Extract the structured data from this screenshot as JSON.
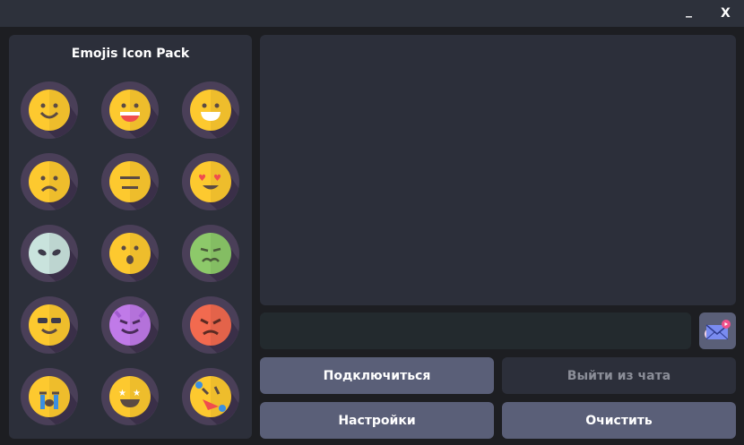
{
  "window": {
    "minimize": "_",
    "close": "X"
  },
  "emoji_panel": {
    "title": "Emojis Icon Pack",
    "emojis": [
      "smile",
      "laugh",
      "grin",
      "sad",
      "neutral",
      "heart-eyes",
      "alien",
      "surprised",
      "sick",
      "cool",
      "devil",
      "angry",
      "crying",
      "star-struck",
      "rofl"
    ]
  },
  "chat": {
    "input_value": ""
  },
  "buttons": {
    "connect": "Подключиться",
    "leave": "Выйти из чата",
    "settings": "Настройки",
    "clear": "Очистить"
  },
  "colors": {
    "button": "#5a5f78",
    "panel": "#2c2f3a",
    "yellow": "#fdc92f"
  }
}
